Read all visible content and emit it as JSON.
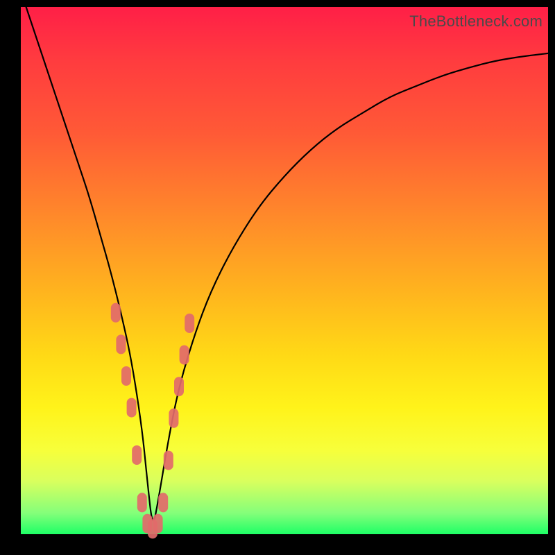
{
  "watermark": "TheBottleneck.com",
  "chart_data": {
    "type": "line",
    "title": "",
    "xlabel": "",
    "ylabel": "",
    "xlim": [
      0,
      100
    ],
    "ylim": [
      0,
      100
    ],
    "grid": false,
    "series": [
      {
        "name": "bottleneck-curve",
        "color": "#000000",
        "x": [
          1,
          3,
          5,
          7,
          9,
          11,
          13,
          15,
          17,
          19,
          21,
          23,
          24,
          25,
          26,
          28,
          30,
          33,
          36,
          40,
          45,
          50,
          55,
          60,
          65,
          70,
          75,
          80,
          85,
          90,
          95,
          100
        ],
        "y": [
          100,
          94,
          88,
          82,
          76,
          70,
          64,
          57,
          50,
          42,
          33,
          20,
          10,
          1,
          6,
          18,
          28,
          38,
          46,
          54,
          62,
          68,
          73,
          77,
          80,
          83,
          85,
          87,
          88.5,
          89.8,
          90.6,
          91.2
        ]
      },
      {
        "name": "highlight-cluster",
        "color": "#e26a6a",
        "marker": "rounded-rect",
        "x": [
          18,
          19,
          20,
          21,
          22,
          23,
          24,
          25,
          26,
          27,
          28,
          29,
          30,
          31,
          32
        ],
        "y": [
          42,
          36,
          30,
          24,
          15,
          6,
          2,
          1,
          2,
          6,
          14,
          22,
          28,
          34,
          40
        ]
      }
    ]
  }
}
